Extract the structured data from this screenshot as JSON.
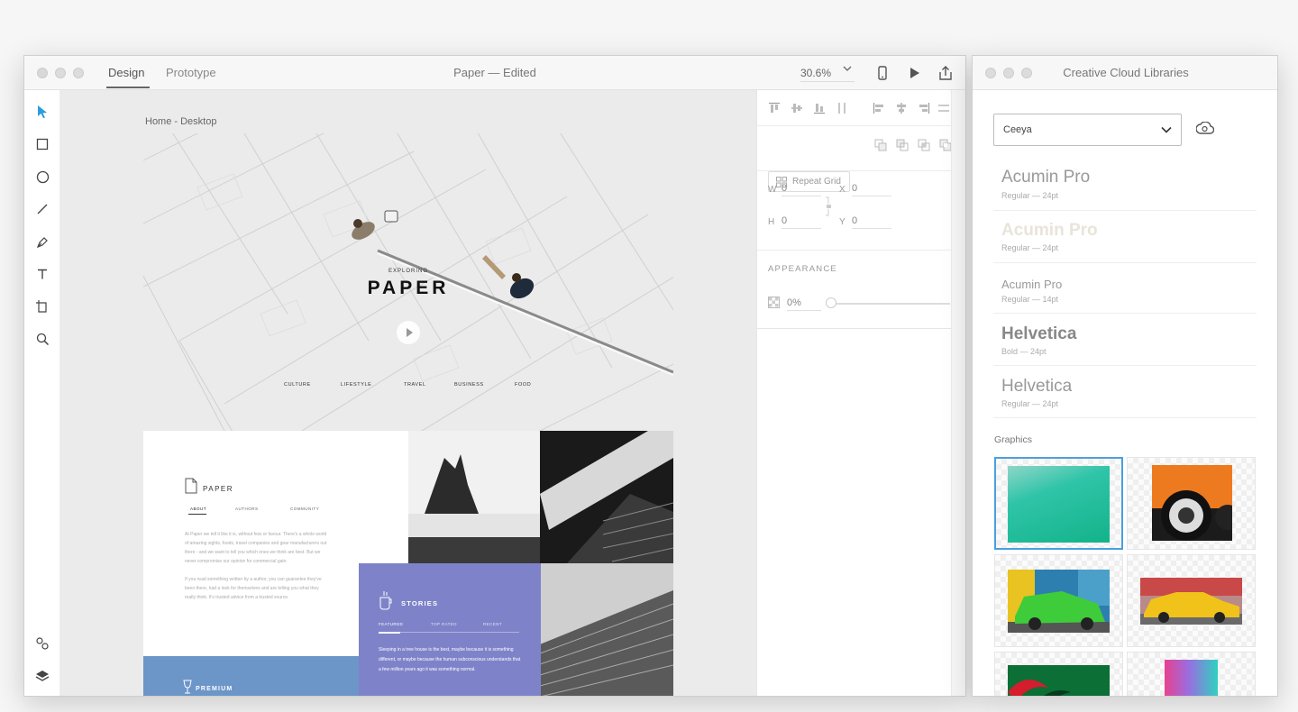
{
  "main_window": {
    "tabs": {
      "design": "Design",
      "prototype": "Prototype"
    },
    "doc_title": "Paper — Edited",
    "zoom": "30.6%"
  },
  "artboard": {
    "label": "Home - Desktop",
    "hero": {
      "kicker": "EXPLORING",
      "title": "PAPER",
      "nav": [
        "CULTURE",
        "LIFESTYLE",
        "TRAVEL",
        "BUSINESS",
        "FOOD"
      ]
    },
    "about": {
      "title": "PAPER",
      "tabs": [
        "ABOUT",
        "AUTHORS",
        "COMMUNITY"
      ],
      "body": [
        "At Paper we tell it like it is, without fear or favour. There's a whole world of amazing sights, foods, travel companies and gear manufacturers out there - and we want to tell you which ones we think are best. But we never compromise our opinion for commercial gain.",
        "If you read something written by a author, you can guarantee they've been there, had a look for themselves and are telling you what they really think. It's trusted advice from a trusted source."
      ]
    },
    "stories": {
      "title": "STORIES",
      "tabs": [
        "FEATURED",
        "TOP RATED",
        "RECENT"
      ],
      "body": "Sleeping in a tree house is the best, maybe because it is something different, or maybe because the human subconscious understands that a few million years ago it was something normal."
    },
    "premium": {
      "title": "PREMIUM"
    }
  },
  "properties": {
    "repeat_grid": "Repeat Grid",
    "w_label": "W",
    "w_value": "0",
    "h_label": "H",
    "h_value": "0",
    "x_label": "X",
    "x_value": "0",
    "y_label": "Y",
    "y_value": "0",
    "appearance_label": "APPEARANCE",
    "opacity": "0%"
  },
  "library": {
    "title": "Creative Cloud Libraries",
    "selected_library": "Ceeya",
    "fonts": [
      {
        "name": "Acumin Pro",
        "meta": "Regular — 24pt"
      },
      {
        "name": "Acumin Pro",
        "meta": "Regular — 24pt"
      },
      {
        "name": "Acumin Pro",
        "meta": "Regular — 14pt"
      },
      {
        "name": "Helvetica",
        "meta": "Bold — 24pt"
      },
      {
        "name": "Helvetica",
        "meta": "Regular — 24pt"
      }
    ],
    "graphics_label": "Graphics"
  },
  "colors": {
    "accent": "#4a9fe0",
    "stories_bg": "#7e83c9",
    "premium_bg": "#6c95c8",
    "selection_tool": "#2d9cdb"
  }
}
